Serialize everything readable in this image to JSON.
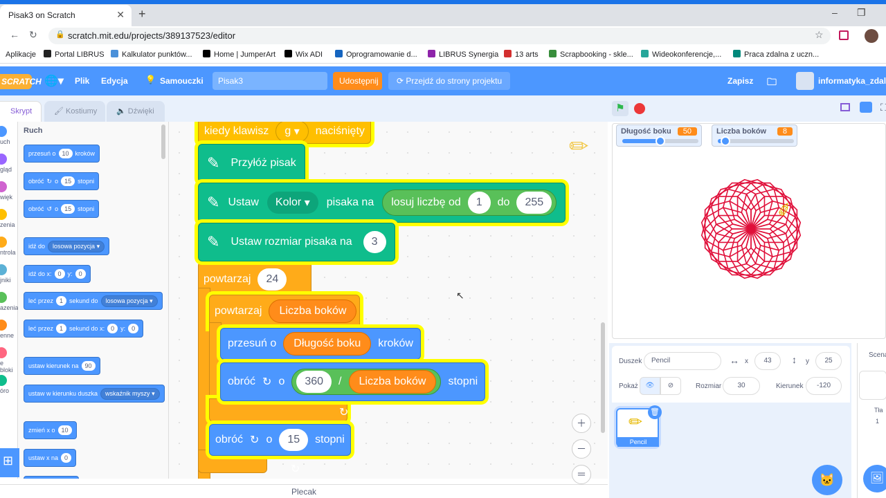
{
  "browser": {
    "tab_title": "Pisak3 on Scratch",
    "url": "scratch.mit.edu/projects/389137523/editor",
    "new_tab": "+",
    "minimize": "–",
    "maximize": "❐"
  },
  "bookmarks": [
    {
      "label": "Aplikacje",
      "color": "#5f6368"
    },
    {
      "label": "Portal LIBRUS",
      "color": "#222"
    },
    {
      "label": "Kalkulator punktów...",
      "color": "#4a90d9"
    },
    {
      "label": "Home | JumperArt",
      "color": "#000"
    },
    {
      "label": "Wix ADI",
      "color": "#000"
    },
    {
      "label": "Oprogramowanie d...",
      "color": "#1565c0"
    },
    {
      "label": "LIBRUS Synergia",
      "color": "#8e24aa"
    },
    {
      "label": "13 arts",
      "color": "#d32f2f"
    },
    {
      "label": "Scrapbooking - skle...",
      "color": "#388e3c"
    },
    {
      "label": "Wideokonferencje,...",
      "color": "#26a69a"
    },
    {
      "label": "Praca zdalna z uczn...",
      "color": "#00897b"
    }
  ],
  "menu": {
    "logo": "SCRATCH",
    "file": "Plik",
    "edit": "Edycja",
    "tutorials": "Samouczki",
    "project_title": "Pisak3",
    "share": "Udostępnij",
    "go_to_project": "Przejdź do strony projektu",
    "save": "Zapisz",
    "username": "informatyka_zdalnie"
  },
  "tabs": {
    "code": "Skrypt",
    "costumes": "Kostiumy",
    "sounds": "Dźwięki"
  },
  "categories": [
    {
      "label": "uch",
      "color": "#4c97ff"
    },
    {
      "label": "gląd",
      "color": "#9966ff"
    },
    {
      "label": "więk",
      "color": "#cf63cf"
    },
    {
      "label": "zenia",
      "color": "#ffbf00"
    },
    {
      "label": "ntrola",
      "color": "#ffab19"
    },
    {
      "label": "jniki",
      "color": "#5cb1d6"
    },
    {
      "label": "azenia",
      "color": "#59c059"
    },
    {
      "label": "enne",
      "color": "#ff8c1a"
    },
    {
      "label": "e bloki",
      "color": "#ff6680"
    },
    {
      "label": "óro",
      "color": "#0fbd8c"
    }
  ],
  "palette": {
    "heading": "Ruch",
    "move": {
      "a": "przesuń o",
      "v": "10",
      "b": "kroków"
    },
    "turn_right": {
      "a": "obróć",
      "b": "o",
      "v": "15",
      "c": "stopni"
    },
    "turn_left": {
      "a": "obróć",
      "b": "o",
      "v": "15",
      "c": "stopni"
    },
    "goto": {
      "a": "idź do",
      "dd": "losowa pozycja"
    },
    "goto_xy": {
      "a": "idź do x:",
      "x": "0",
      "b": "y:",
      "y": "0"
    },
    "glide": {
      "a": "leć przez",
      "v": "1",
      "b": "sekund do",
      "dd": "losowa pozycja"
    },
    "glide_xy": {
      "a": "leć przez",
      "v": "1",
      "b": "sekund do x:",
      "x": "0",
      "c": "y:",
      "y": "0"
    },
    "point_dir": {
      "a": "ustaw kierunek na",
      "v": "90"
    },
    "point_towards": {
      "a": "ustaw w kierunku duszka",
      "dd": "wskaźnik myszy"
    },
    "change_x": {
      "a": "zmień x o",
      "v": "10"
    },
    "set_x": {
      "a": "ustaw x na",
      "v": "0"
    }
  },
  "script": {
    "hat": {
      "a": "kiedy klawisz",
      "key": "g",
      "b": "naciśnięty"
    },
    "pen_down": "Przyłóż pisak",
    "set_color": {
      "a": "Ustaw",
      "dd": "Kolor",
      "b": "pisaka na",
      "rand": "losuj liczbę od",
      "from": "1",
      "to_label": "do",
      "to": "255"
    },
    "set_size": {
      "a": "Ustaw rozmiar pisaka na",
      "v": "3"
    },
    "repeat_outer": {
      "a": "powtarzaj",
      "v": "24"
    },
    "repeat_inner": {
      "a": "powtarzaj",
      "var": "Liczba boków"
    },
    "move": {
      "a": "przesuń o",
      "var": "Długość boku",
      "b": "kroków"
    },
    "turn": {
      "a": "obróć",
      "b": "o",
      "num": "360",
      "slash": "/",
      "var": "Liczba boków",
      "c": "stopni"
    },
    "turn2": {
      "a": "obróć",
      "b": "o",
      "v": "15",
      "c": "stopni"
    }
  },
  "backpack": "Plecak",
  "stage": {
    "monitors": [
      {
        "label": "Długość boku",
        "value": "50",
        "slider": 0.5
      },
      {
        "label": "Liczba boków",
        "value": "8",
        "slider": 0.1
      }
    ]
  },
  "sprite": {
    "sprite_label": "Duszek",
    "name": "Pencil",
    "x_label": "x",
    "x": "43",
    "y_label": "y",
    "y": "25",
    "show_label": "Pokaż",
    "size_label": "Rozmiar",
    "size": "30",
    "dir_label": "Kierunek",
    "dir": "-120",
    "thumb_name": "Pencil"
  },
  "scene": {
    "title": "Scena",
    "backdrops_label": "Tła",
    "backdrops_count": "1"
  }
}
